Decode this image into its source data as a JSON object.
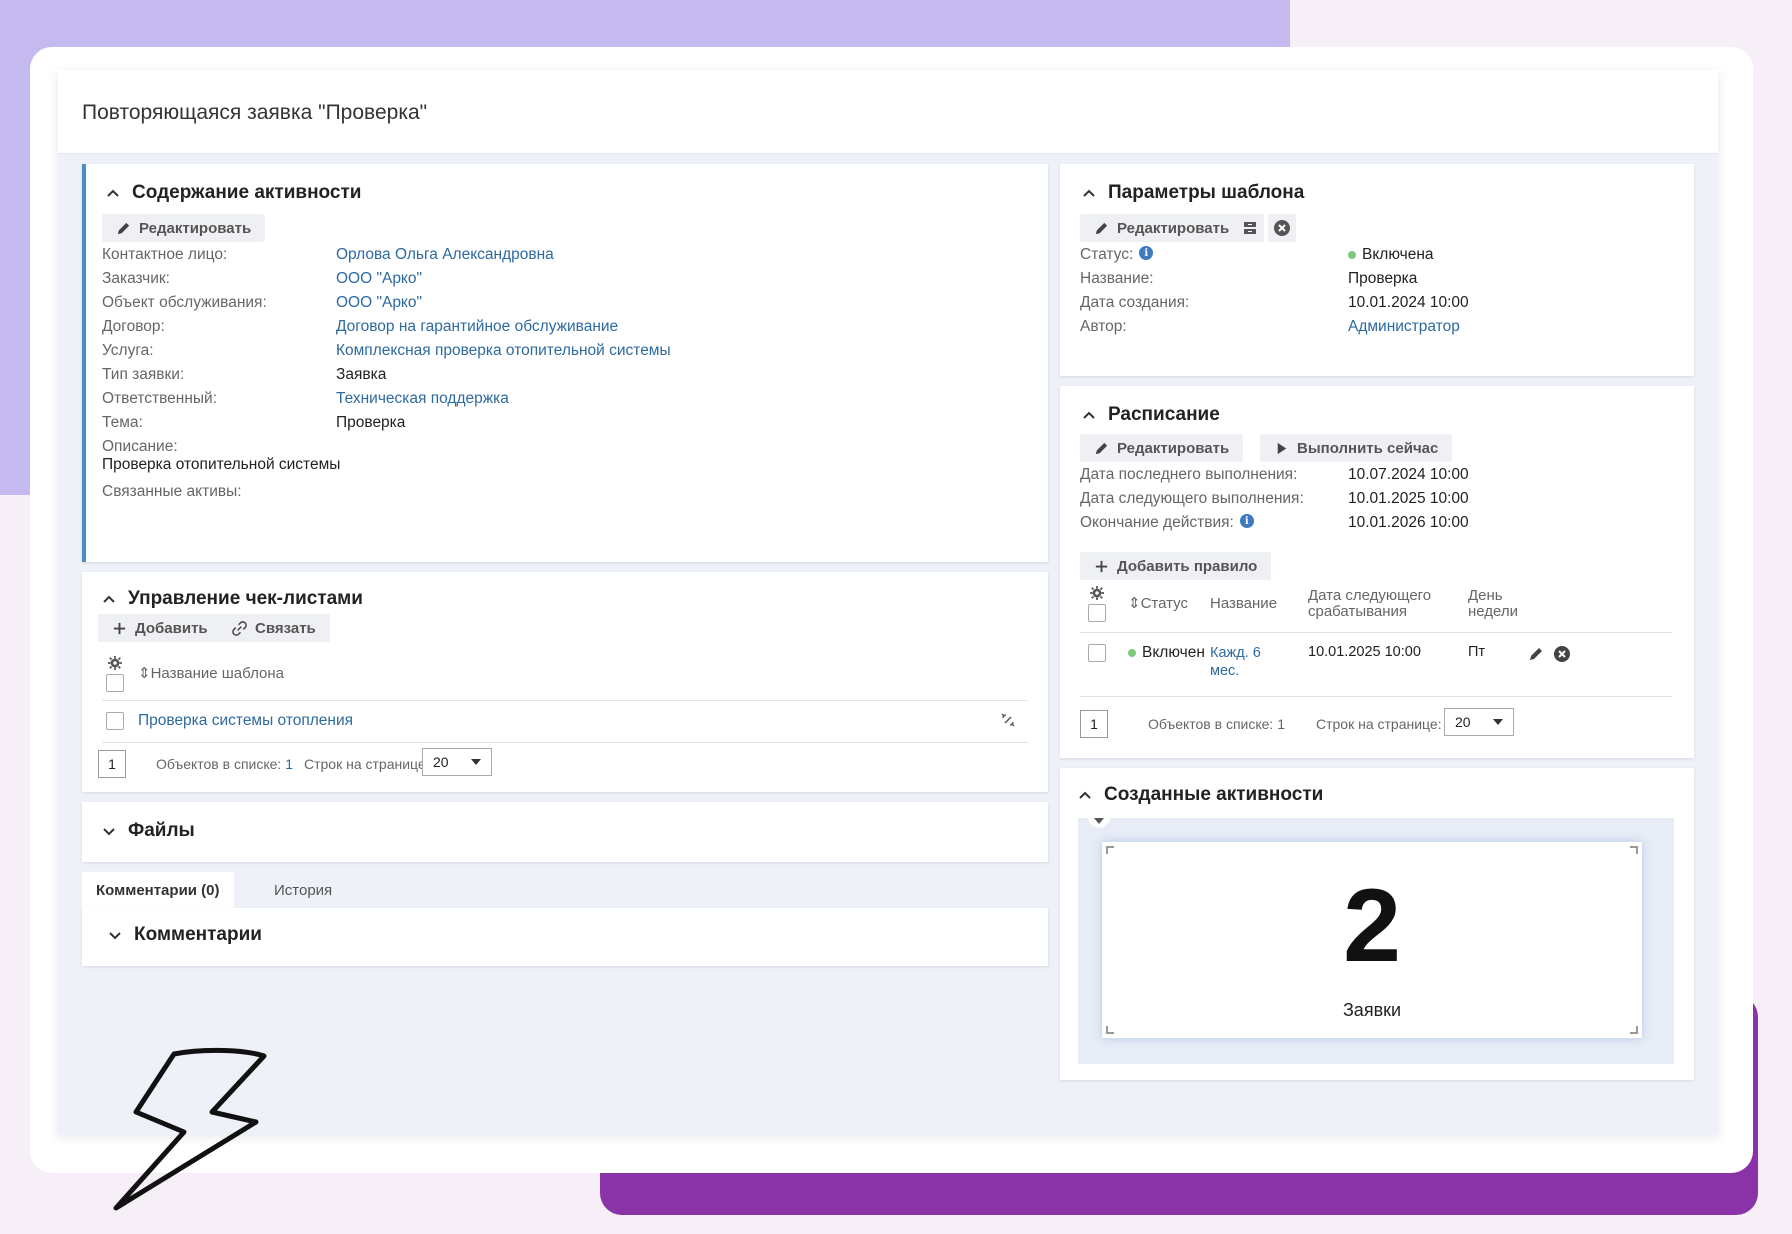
{
  "header": {
    "title": "Повторяющаяся заявка \"Проверка\""
  },
  "activity": {
    "title": "Содержание активности",
    "edit_label": "Редактировать",
    "fields": [
      {
        "label": "Контактное лицо:",
        "value": "Орлова Ольга Александровна"
      },
      {
        "label": "Заказчик:",
        "value": "ООО \"Арко\""
      },
      {
        "label": "Объект обслуживания:",
        "value": "ООО \"Арко\""
      },
      {
        "label": "Договор:",
        "value": "Договор на гарантийное обслуживание"
      },
      {
        "label": "Услуга:",
        "value": "Комплексная проверка отопительной системы"
      },
      {
        "label": "Тип заявки:",
        "value": "Заявка"
      },
      {
        "label": "Ответственный:",
        "value": "Техническая поддержка"
      },
      {
        "label": "Тема:",
        "value": "Проверка"
      }
    ],
    "description_label": "Описание:",
    "description_value": "Проверка отопительной системы",
    "assets_label": "Связанные активы:"
  },
  "checklists": {
    "title": "Управление чек-листами",
    "add_label": "Добавить",
    "link_label": "Связать",
    "column_name": "Название шаблона",
    "rows": [
      {
        "name": "Проверка системы отопления"
      }
    ],
    "page": "1",
    "objects_label": "Объектов в списке:",
    "objects_count": "1",
    "rows_label": "Строк на странице:",
    "rows_per_page": "20"
  },
  "files": {
    "title": "Файлы"
  },
  "tabs": [
    {
      "label": "Комментарии (0)"
    },
    {
      "label": "История"
    }
  ],
  "comments": {
    "title": "Комментарии"
  },
  "template": {
    "title": "Параметры шаблона",
    "edit_label": "Редактировать",
    "status_label": "Статус:",
    "status_value": "Включена",
    "name_label": "Название:",
    "name_value": "Проверка",
    "created_label": "Дата создания:",
    "created_value": "10.01.2024 10:00",
    "author_label": "Автор:",
    "author_value": "Администратор"
  },
  "schedule": {
    "title": "Расписание",
    "edit_label": "Редактировать",
    "run_label": "Выполнить сейчас",
    "last_label": "Дата последнего выполнения:",
    "last_value": "10.07.2024 10:00",
    "next_label": "Дата следующего выполнения:",
    "next_value": "10.01.2025 10:00",
    "end_label": "Окончание действия:",
    "end_value": "10.01.2026 10:00",
    "add_rule_label": "Добавить правило",
    "columns": {
      "status": "Статус",
      "name": "Название",
      "next_line1": "Дата следующего",
      "next_line2": "срабатывания",
      "day_line1": "День",
      "day_line2": "недели"
    },
    "rules": [
      {
        "status": "Включен",
        "name_line1": "Кажд. 6",
        "name_line2": "мес.",
        "next": "10.01.2025 10:00",
        "day": "Пт"
      }
    ],
    "page": "1",
    "objects_label": "Объектов в списке:",
    "objects_count": "1",
    "rows_label": "Строк на странице:",
    "rows_per_page": "20"
  },
  "created": {
    "title": "Созданные активности",
    "count": "2",
    "count_label": "Заявки"
  },
  "colors": {
    "accent": "#4c8dc6",
    "link": "#2d6aa0",
    "status_green": "#7cc97c",
    "deco_lavender": "#c5baf0",
    "deco_purple": "#8a33a8"
  }
}
